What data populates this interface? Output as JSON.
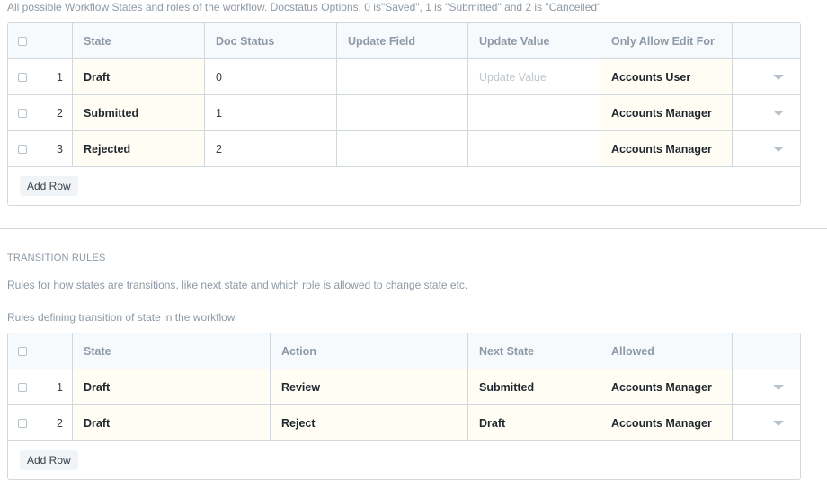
{
  "states_section": {
    "description": "All possible Workflow States and roles of the workflow. Docstatus Options: 0 is\"Saved\", 1 is \"Submitted\" and 2 is \"Cancelled\"",
    "columns": [
      "State",
      "Doc Status",
      "Update Field",
      "Update Value",
      "Only Allow Edit For"
    ],
    "rows": [
      {
        "idx": "1",
        "state": "Draft",
        "doc_status": "0",
        "update_field": "",
        "update_value": "",
        "update_value_placeholder": "Update Value",
        "allow_edit_for": "Accounts User"
      },
      {
        "idx": "2",
        "state": "Submitted",
        "doc_status": "1",
        "update_field": "",
        "update_value": "",
        "update_value_placeholder": "",
        "allow_edit_for": "Accounts Manager"
      },
      {
        "idx": "3",
        "state": "Rejected",
        "doc_status": "2",
        "update_field": "",
        "update_value": "",
        "update_value_placeholder": "",
        "allow_edit_for": "Accounts Manager"
      }
    ],
    "add_row_label": "Add Row"
  },
  "transitions_section": {
    "heading": "TRANSITION RULES",
    "intro": "Rules for how states are transitions, like next state and which role is allowed to change state etc.",
    "description": "Rules defining transition of state in the workflow.",
    "columns": [
      "State",
      "Action",
      "Next State",
      "Allowed"
    ],
    "rows": [
      {
        "idx": "1",
        "state": "Draft",
        "action": "Review",
        "next_state": "Submitted",
        "allowed": "Accounts Manager"
      },
      {
        "idx": "2",
        "state": "Draft",
        "action": "Reject",
        "next_state": "Draft",
        "allowed": "Accounts Manager"
      }
    ],
    "add_row_label": "Add Row"
  }
}
